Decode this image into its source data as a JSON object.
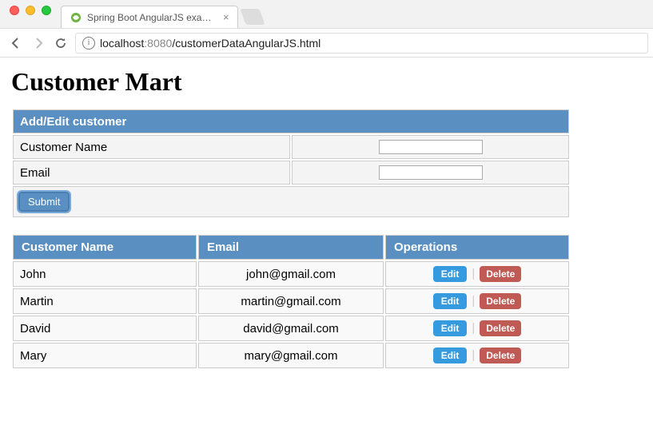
{
  "browser": {
    "tab_title": "Spring Boot AngularJS examp",
    "url_host": "localhost",
    "url_port": ":8080",
    "url_path": "/customerDataAngularJS.html"
  },
  "page": {
    "title": "Customer Mart"
  },
  "form": {
    "header": "Add/Edit customer",
    "name_label": "Customer Name",
    "email_label": "Email",
    "name_value": "",
    "email_value": "",
    "submit_label": "Submit"
  },
  "table": {
    "headers": {
      "name": "Customer Name",
      "email": "Email",
      "ops": "Operations"
    },
    "edit_label": "Edit",
    "delete_label": "Delete",
    "rows": [
      {
        "name": "John",
        "email": "john@gmail.com"
      },
      {
        "name": "Martin",
        "email": "martin@gmail.com"
      },
      {
        "name": "David",
        "email": "david@gmail.com"
      },
      {
        "name": "Mary",
        "email": "mary@gmail.com"
      }
    ]
  }
}
